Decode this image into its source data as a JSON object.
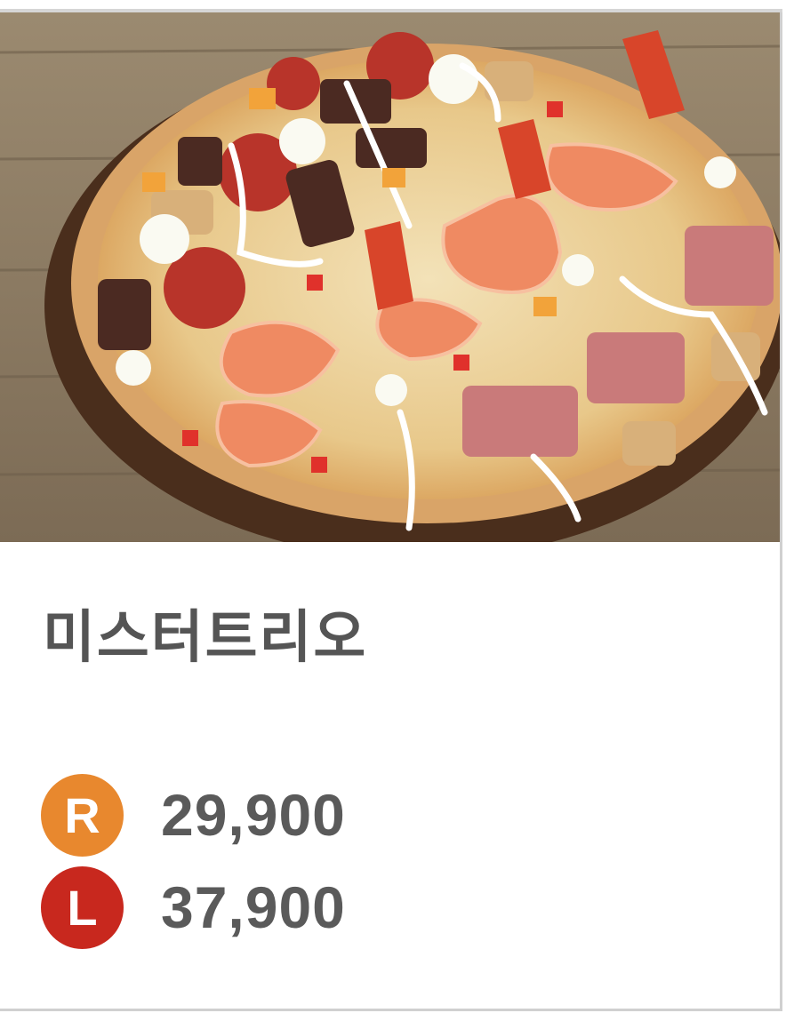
{
  "product": {
    "name": "미스터트리오",
    "image_alt": "pizza-photo"
  },
  "prices": [
    {
      "size": "R",
      "price": "29,900",
      "color": "#E8882E"
    },
    {
      "size": "L",
      "price": "37,900",
      "color": "#C8281E"
    }
  ],
  "colors": {
    "text": "#555555",
    "border": "#d0d0d0",
    "wood": "#8a7a63"
  }
}
